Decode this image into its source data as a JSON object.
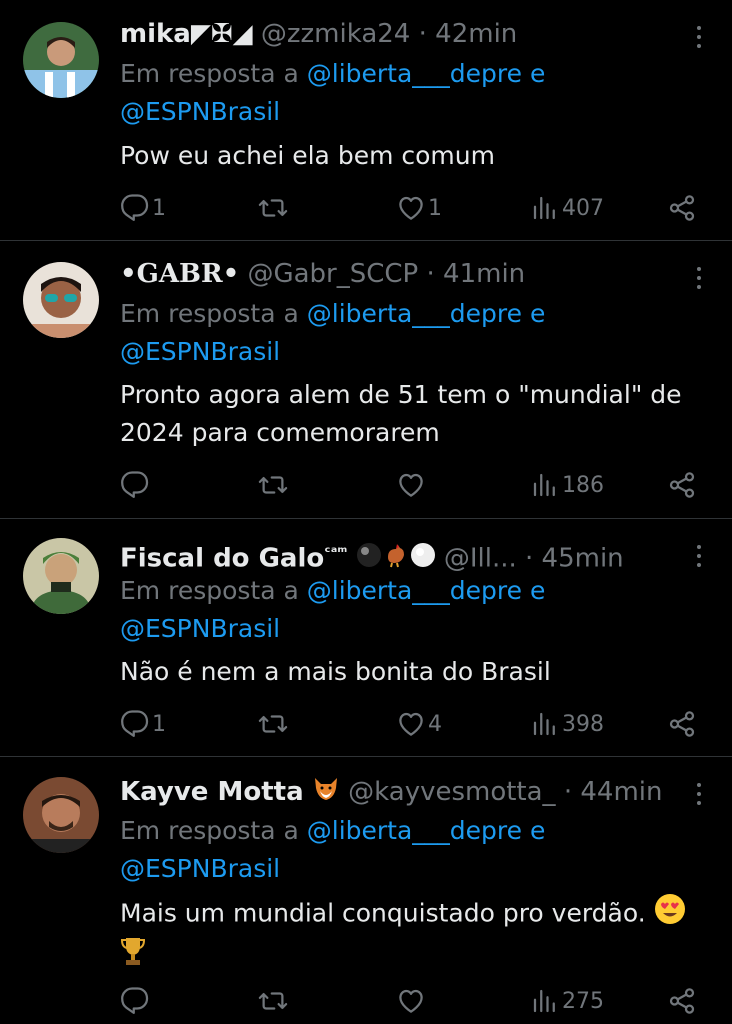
{
  "reply_prefix": "Em resposta a",
  "reply_conj": "e",
  "tweets": [
    {
      "name": "mika◤✠◢",
      "handle": "@zzmika24",
      "time": "42min",
      "reply_to_1": "@liberta___depre",
      "reply_to_2": "@ESPNBrasil",
      "text": "Pow eu achei ela bem comum",
      "replies": "1",
      "retweets": "",
      "likes": "1",
      "views": "407"
    },
    {
      "name": "•GABR•",
      "handle": "@Gabr_SCCP",
      "time": "41min",
      "reply_to_1": "@liberta___depre",
      "reply_to_2": "@ESPNBrasil",
      "text": "Pronto agora alem de 51 tem o \"mundial\" de 2024 para comemorarem",
      "replies": "",
      "retweets": "",
      "likes": "",
      "views": "186"
    },
    {
      "name": "Fiscal do Galo",
      "name_suffix": "ᶜᵃᵐ",
      "handle": "@Ill...",
      "time": "45min",
      "reply_to_1": "@liberta___depre",
      "reply_to_2": "@ESPNBrasil",
      "text": "Não é nem a mais bonita do Brasil",
      "replies": "1",
      "retweets": "",
      "likes": "4",
      "views": "398"
    },
    {
      "name": "Kayve Motta",
      "handle": "@kayvesmotta_",
      "time": "44min",
      "reply_to_1": "@liberta___depre",
      "reply_to_2": "@ESPNBrasil",
      "text": "Mais um mundial conquistado pro verdão.",
      "replies": "",
      "retweets": "",
      "likes": "",
      "views": "275"
    }
  ],
  "icons": {
    "reply": "reply-icon",
    "retweet": "retweet-icon",
    "like": "heart-icon",
    "views": "views-icon",
    "share": "share-icon",
    "more": "more-icon"
  },
  "colors": {
    "link": "#1d9bf0",
    "muted": "#71767b",
    "text": "#e7e9ea",
    "border": "#2f3336"
  }
}
